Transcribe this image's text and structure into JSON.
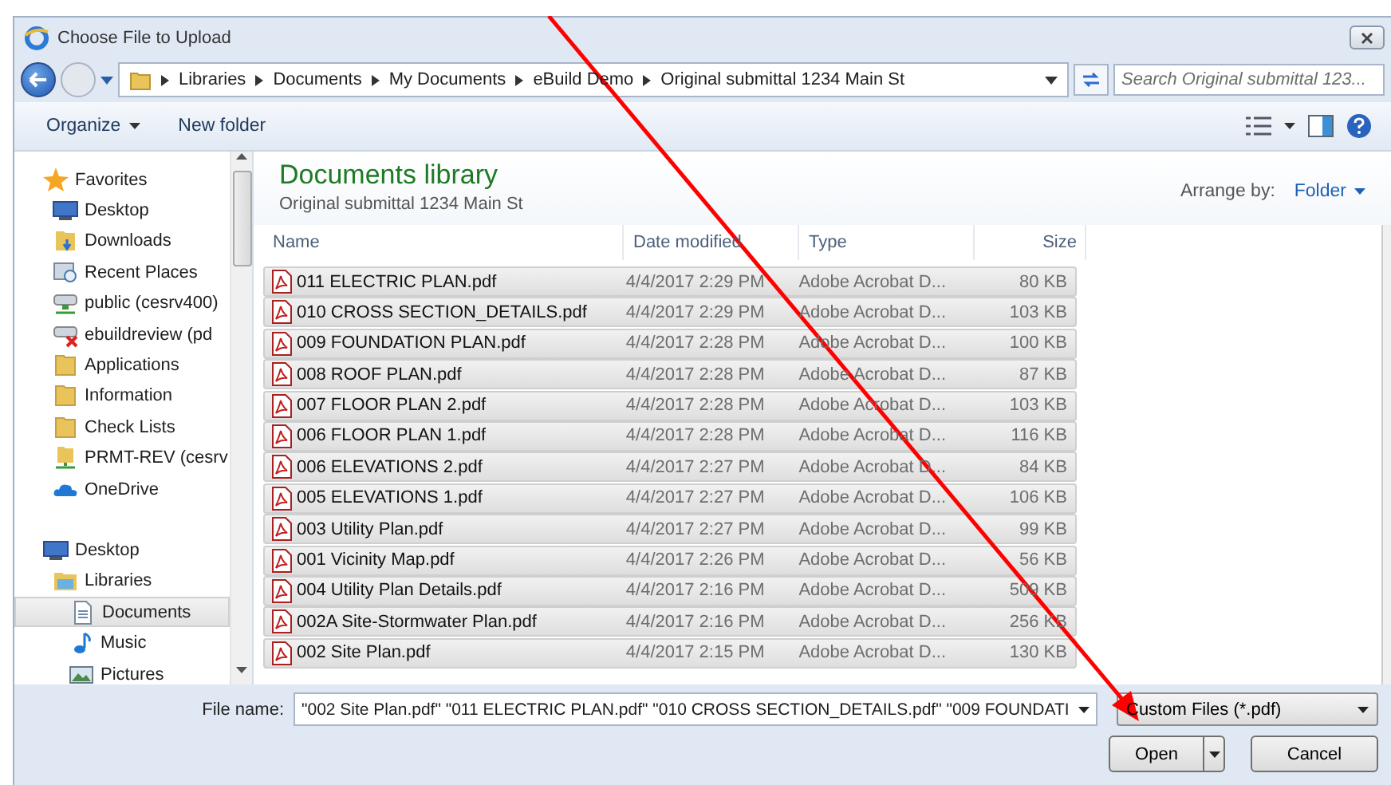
{
  "window": {
    "title": "Choose File to Upload"
  },
  "address": {
    "crumbs": [
      "Libraries",
      "Documents",
      "My Documents",
      "eBuild Demo",
      "Original submittal 1234 Main St"
    ],
    "search_placeholder": "Search Original submittal 123..."
  },
  "toolbar": {
    "organize": "Organize",
    "new_folder": "New folder"
  },
  "sidebar": {
    "items": [
      {
        "label": "Favorites",
        "kind": "star",
        "selected": false,
        "children": [
          {
            "label": "Desktop",
            "kind": "desktop",
            "selected": false
          },
          {
            "label": "Downloads",
            "kind": "download",
            "selected": false
          },
          {
            "label": "Recent Places",
            "kind": "recent",
            "selected": false
          },
          {
            "label": "public (cesrv400)",
            "kind": "netdrive",
            "selected": false
          },
          {
            "label": "ebuildreview (pd",
            "kind": "offline",
            "selected": false
          },
          {
            "label": "Applications",
            "kind": "folder",
            "selected": false
          },
          {
            "label": "Information",
            "kind": "folder",
            "selected": false
          },
          {
            "label": "Check Lists",
            "kind": "folder",
            "selected": false
          },
          {
            "label": "PRMT-REV (cesrv",
            "kind": "netfolder",
            "selected": false
          },
          {
            "label": "OneDrive",
            "kind": "cloud",
            "selected": false
          }
        ]
      },
      {
        "label": "Desktop",
        "kind": "desktop",
        "selected": false,
        "children": [
          {
            "label": "Libraries",
            "kind": "library",
            "selected": false,
            "children": [
              {
                "label": "Documents",
                "kind": "document",
                "selected": true
              },
              {
                "label": "Music",
                "kind": "music",
                "selected": false
              },
              {
                "label": "Pictures",
                "kind": "picture",
                "selected": false
              }
            ]
          }
        ]
      }
    ]
  },
  "library": {
    "title": "Documents library",
    "subtitle": "Original submittal 1234 Main St",
    "arrange_label": "Arrange by:",
    "arrange_value": "Folder"
  },
  "table": {
    "columns": [
      "Name",
      "Date modified",
      "Type",
      "Size"
    ],
    "rows": [
      {
        "name": "011 ELECTRIC PLAN.pdf",
        "date": "4/4/2017 2:29 PM",
        "type": "Adobe Acrobat D...",
        "size": "80 KB",
        "selected": true
      },
      {
        "name": "010 CROSS SECTION_DETAILS.pdf",
        "date": "4/4/2017 2:29 PM",
        "type": "Adobe Acrobat D...",
        "size": "103 KB",
        "selected": true
      },
      {
        "name": "009 FOUNDATION PLAN.pdf",
        "date": "4/4/2017 2:28 PM",
        "type": "Adobe Acrobat D...",
        "size": "100 KB",
        "selected": true
      },
      {
        "name": "008 ROOF PLAN.pdf",
        "date": "4/4/2017 2:28 PM",
        "type": "Adobe Acrobat D...",
        "size": "87 KB",
        "selected": true
      },
      {
        "name": "007 FLOOR PLAN 2.pdf",
        "date": "4/4/2017 2:28 PM",
        "type": "Adobe Acrobat D...",
        "size": "103 KB",
        "selected": true
      },
      {
        "name": "006 FLOOR PLAN 1.pdf",
        "date": "4/4/2017 2:28 PM",
        "type": "Adobe Acrobat D...",
        "size": "116 KB",
        "selected": true
      },
      {
        "name": "006 ELEVATIONS 2.pdf",
        "date": "4/4/2017 2:27 PM",
        "type": "Adobe Acrobat D...",
        "size": "84 KB",
        "selected": true
      },
      {
        "name": "005 ELEVATIONS 1.pdf",
        "date": "4/4/2017 2:27 PM",
        "type": "Adobe Acrobat D...",
        "size": "106 KB",
        "selected": true
      },
      {
        "name": "003 Utility Plan.pdf",
        "date": "4/4/2017 2:27 PM",
        "type": "Adobe Acrobat D...",
        "size": "99 KB",
        "selected": true
      },
      {
        "name": "001 Vicinity Map.pdf",
        "date": "4/4/2017 2:26 PM",
        "type": "Adobe Acrobat D...",
        "size": "56 KB",
        "selected": true
      },
      {
        "name": "004 Utility Plan Details.pdf",
        "date": "4/4/2017 2:16 PM",
        "type": "Adobe Acrobat D...",
        "size": "509 KB",
        "selected": true
      },
      {
        "name": "002A Site-Stormwater Plan.pdf",
        "date": "4/4/2017 2:16 PM",
        "type": "Adobe Acrobat D...",
        "size": "256 KB",
        "selected": true
      },
      {
        "name": "002 Site Plan.pdf",
        "date": "4/4/2017 2:15 PM",
        "type": "Adobe Acrobat D...",
        "size": "130 KB",
        "selected": true
      }
    ]
  },
  "bottom": {
    "file_name_label": "File name:",
    "file_name_value": "\"002 Site Plan.pdf\" \"011 ELECTRIC PLAN.pdf\" \"010 CROSS SECTION_DETAILS.pdf\" \"009 FOUNDATI",
    "filter": "Custom Files (*.pdf)",
    "open": "Open",
    "cancel": "Cancel"
  }
}
